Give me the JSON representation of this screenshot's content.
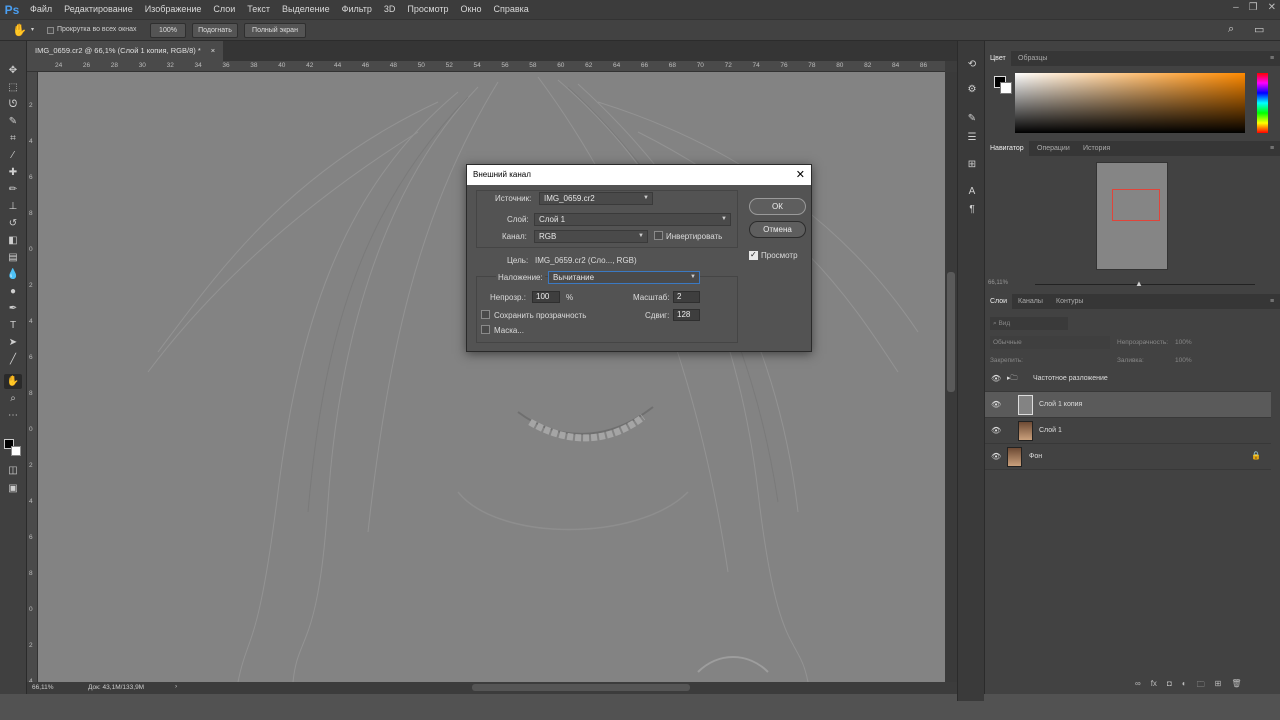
{
  "app": {
    "logo": "Ps"
  },
  "menu": [
    "Файл",
    "Редактирование",
    "Изображение",
    "Слои",
    "Текст",
    "Выделение",
    "Фильтр",
    "3D",
    "Просмотр",
    "Окно",
    "Справка"
  ],
  "window_controls": [
    "–",
    "❐",
    "✕"
  ],
  "options": {
    "scroll_all_label": "Прокрутка во всех окнах",
    "zoom": "100%",
    "fit": "Подогнать",
    "fullscreen": "Полный экран"
  },
  "document": {
    "tab_title": "IMG_0659.cr2 @ 66,1% (Слой 1 копия, RGB/8) *",
    "tab_close": "×",
    "ruler_h": [
      "24",
      "26",
      "28",
      "30",
      "32",
      "34",
      "36",
      "38",
      "40",
      "42",
      "44",
      "46",
      "48",
      "50",
      "52",
      "54",
      "56",
      "58",
      "60",
      "62",
      "64",
      "66",
      "68",
      "70",
      "72",
      "74",
      "76",
      "78",
      "80",
      "82",
      "84",
      "86"
    ],
    "ruler_v": [
      "2",
      "4",
      "6",
      "8",
      "0",
      "2",
      "4",
      "6",
      "8",
      "0",
      "2",
      "4",
      "6",
      "8",
      "0",
      "2",
      "4"
    ],
    "status_zoom": "66,11%",
    "status_doc": "Док: 43,1M/133,9M"
  },
  "dialog": {
    "title": "Внешний канал",
    "close": "✕",
    "source_label": "Источник:",
    "source_value": "IMG_0659.cr2",
    "layer_label": "Слой:",
    "layer_value": "Слой 1",
    "channel_label": "Канал:",
    "channel_value": "RGB",
    "invert_label": "Инвертировать",
    "target_label": "Цель:",
    "target_value": "IMG_0659.cr2 (Сло..., RGB)",
    "blending_label": "Наложение:",
    "blending_value": "Вычитание",
    "opacity_label": "Непрозр.:",
    "opacity_value": "100",
    "opacity_unit": "%",
    "scale_label": "Масштаб:",
    "scale_value": "2",
    "preserve_label": "Сохранить прозрачность",
    "offset_label": "Сдвиг:",
    "offset_value": "128",
    "mask_label": "Маска...",
    "ok": "ОК",
    "cancel": "Отмена",
    "preview_label": "Просмотр"
  },
  "panels": {
    "color_tabs": [
      "Цвет",
      "Образцы"
    ],
    "nav_tabs": [
      "Навигатор",
      "Операции",
      "История"
    ],
    "nav_zoom": "66,11%",
    "layers_tabs": [
      "Слои",
      "Каналы",
      "Контуры"
    ],
    "layers_search": "Вид",
    "blend_mode": "Обычные",
    "opacity_label": "Непрозрачность:",
    "opacity_value": "100%",
    "lock_label": "Закрепить:",
    "fill_label": "Заливка:",
    "fill_value": "100%",
    "layers": [
      {
        "name": "Частотное разложение",
        "type": "group"
      },
      {
        "name": "Слой 1 копия",
        "type": "layer",
        "selected": true
      },
      {
        "name": "Слой 1",
        "type": "layer"
      },
      {
        "name": "Фон",
        "type": "background",
        "locked": true
      }
    ]
  },
  "colors": {
    "accent": "#4a9ff2",
    "nav_box": "#e0443a"
  }
}
